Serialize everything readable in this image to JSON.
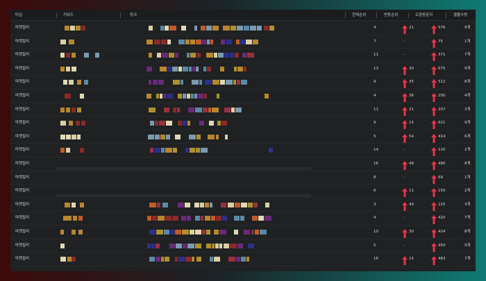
{
  "colors": {
    "background_left": "#3d0a0a",
    "background_right": "#0f7a74",
    "panel": "#1f2122",
    "text": "#d4d7d9",
    "arrow": "#e8344a"
  },
  "header": {
    "type": "타입",
    "keyword": "키워드",
    "link": "링크",
    "current_rank": "현재순위",
    "rank_change": "변동순위",
    "visitors": "오잠방문자",
    "quantity": "결불수량"
  },
  "icons": {
    "rank_change_up": "arrow-up-icon",
    "visitors_up": "arrow-up-icon"
  },
  "rows": [
    {
      "type": "마켓컬리",
      "rank": "4",
      "change": "21",
      "change_up": true,
      "visitors": "576",
      "qty": "9개"
    },
    {
      "type": "마켓컬리",
      "rank": "7",
      "change": "-",
      "change_up": false,
      "visitors": "75",
      "qty": "1개"
    },
    {
      "type": "마켓컬리",
      "rank": "11",
      "change": "-",
      "change_up": false,
      "visitors": "371",
      "qty": "7개"
    },
    {
      "type": "마켓컬리",
      "rank": "13",
      "change": "30",
      "change_up": true,
      "visitors": "675",
      "qty": "9개"
    },
    {
      "type": "마켓컬리",
      "rank": "9",
      "change": "35",
      "change_up": true,
      "visitors": "512",
      "qty": "8개"
    },
    {
      "type": "마켓컬리",
      "rank": "4",
      "change": "36",
      "change_up": true,
      "visitors": "200",
      "qty": "4개"
    },
    {
      "type": "마켓컬리",
      "rank": "11",
      "change": "21",
      "change_up": true,
      "visitors": "207",
      "qty": "3개"
    },
    {
      "type": "마켓컬리",
      "rank": "9",
      "change": "15",
      "change_up": true,
      "visitors": "621",
      "qty": "9개"
    },
    {
      "type": "마켓컬리",
      "rank": "5",
      "change": "54",
      "change_up": true,
      "visitors": "414",
      "qty": "6개"
    },
    {
      "type": "마켓컬리",
      "rank": "14",
      "change": "-",
      "change_up": false,
      "visitors": "120",
      "qty": "2개"
    },
    {
      "type": "마켓컬리",
      "rank": "16",
      "change": "48",
      "change_up": true,
      "visitors": "480",
      "qty": "8개"
    },
    {
      "type": "마켓컬리",
      "rank": "8",
      "change": "-",
      "change_up": false,
      "visitors": "69",
      "qty": "1개"
    },
    {
      "type": "마켓컬리",
      "rank": "6",
      "change": "11",
      "change_up": true,
      "visitors": "150",
      "qty": "2개"
    },
    {
      "type": "마켓컬리",
      "rank": "3",
      "change": "49",
      "change_up": true,
      "visitors": "225",
      "qty": "3개"
    },
    {
      "type": "마켓컬리",
      "rank": "4",
      "change": "-",
      "change_up": false,
      "visitors": "420",
      "qty": "7개"
    },
    {
      "type": "마켓컬리",
      "rank": "10",
      "change": "30",
      "change_up": true,
      "visitors": "424",
      "qty": "8개"
    },
    {
      "type": "마켓컬리",
      "rank": "5",
      "change": "-",
      "change_up": false,
      "visitors": "450",
      "qty": "9개"
    },
    {
      "type": "마켓컬리",
      "rank": "16",
      "change": "15",
      "change_up": true,
      "visitors": "483",
      "qty": "7개"
    }
  ]
}
